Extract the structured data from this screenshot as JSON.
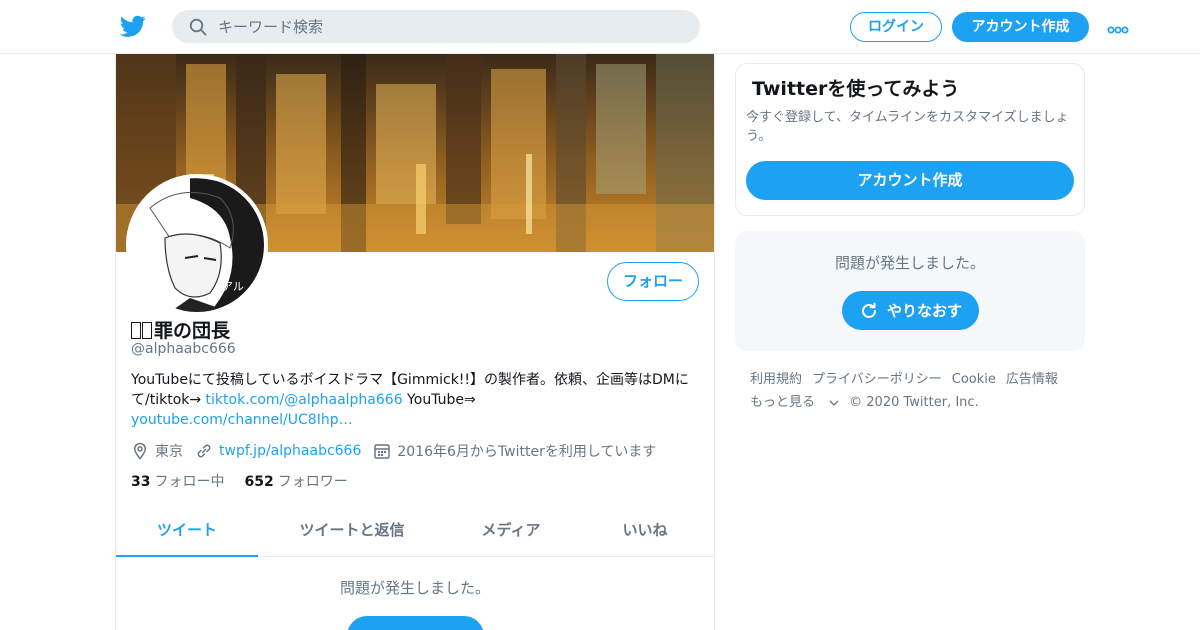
{
  "header": {
    "search_placeholder": "キーワード検索",
    "login_label": "ログイン",
    "signup_label": "アカウント作成",
    "brand_color": "#1da1f2"
  },
  "profile": {
    "follow_label": "フォロー",
    "display_name": "罪の団長",
    "handle": "@alphaabc666",
    "bio_text_1": "YouTubeにて投稿しているボイスドラマ【Gimmick!!】の製作者。依頼、企画等はDMにて/tiktok→ ",
    "bio_link_1": "tiktok.com/@alphaalpha666",
    "bio_text_2": " YouTube⇒ ",
    "bio_link_2": "youtube.com/channel/UC8Ihp…",
    "location": "東京",
    "website": "twpf.jp/alphaabc666",
    "joined": "2016年6月からTwitterを利用しています",
    "following_count": "33",
    "following_label": "フォロー中",
    "followers_count": "652",
    "followers_label": "フォロワー"
  },
  "tabs": [
    {
      "label": "ツイート",
      "active": true
    },
    {
      "label": "ツイートと返信",
      "active": false
    },
    {
      "label": "メディア",
      "active": false
    },
    {
      "label": "いいね",
      "active": false
    }
  ],
  "timeline": {
    "error_text": "問題が発生しました。"
  },
  "sidebar": {
    "signup_title": "Twitterを使ってみよう",
    "signup_desc": "今すぐ登録して、タイムラインをカスタマイズしましょう。",
    "signup_button": "アカウント作成",
    "error_text": "問題が発生しました。",
    "retry_label": "やりなおす"
  },
  "footer": {
    "links": [
      "利用規約",
      "プライバシーポリシー",
      "Cookie",
      "広告情報",
      "もっと見る",
      "© 2020 Twitter, Inc."
    ]
  }
}
